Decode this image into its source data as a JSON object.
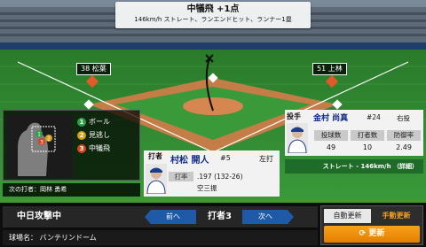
{
  "play": {
    "title": "中犠飛 +1点",
    "detail": "146km/h ストレート、ランエンドヒット、ランナー1塁"
  },
  "fielders": {
    "left": "38 松葉",
    "right": "51 上林"
  },
  "count_legend": {
    "items": [
      {
        "num": "1",
        "label": "ボール",
        "color": "#2e9e4a"
      },
      {
        "num": "2",
        "label": "見逃し",
        "color": "#d4a017"
      },
      {
        "num": "3",
        "label": "中犠飛",
        "color": "#d9431e"
      }
    ]
  },
  "next_batter": "次の打者：岡林 勇希",
  "batter": {
    "role": "打者",
    "name": "村松 開人",
    "number": "#5",
    "side": "左打",
    "stats": [
      {
        "key": "打率",
        "value": ".197 (132-26)"
      },
      {
        "key": "",
        "value": "空三振"
      }
    ]
  },
  "pitcher": {
    "role": "投手",
    "name": "金村 尚真",
    "number": "#24",
    "side": "右投",
    "headers": [
      "投球数",
      "打者数",
      "防御率"
    ],
    "values": [
      "49",
      "10",
      "2.49"
    ]
  },
  "pitch_info": "ストレート - 146km/h （詳細）",
  "bottom": {
    "attack": "中日攻撃中",
    "prev": "前へ",
    "batter_index": "打者3",
    "next": "次へ",
    "stadium": "球場名： バンテリンドーム",
    "auto_update": "自動更新",
    "manual_update": "手動更新",
    "refresh": "更新"
  },
  "colors": {
    "grass": "#2f8a2f",
    "dirt": "#d6874f",
    "accent_blue": "#1e5aa8",
    "accent_orange": "#f39a12"
  }
}
